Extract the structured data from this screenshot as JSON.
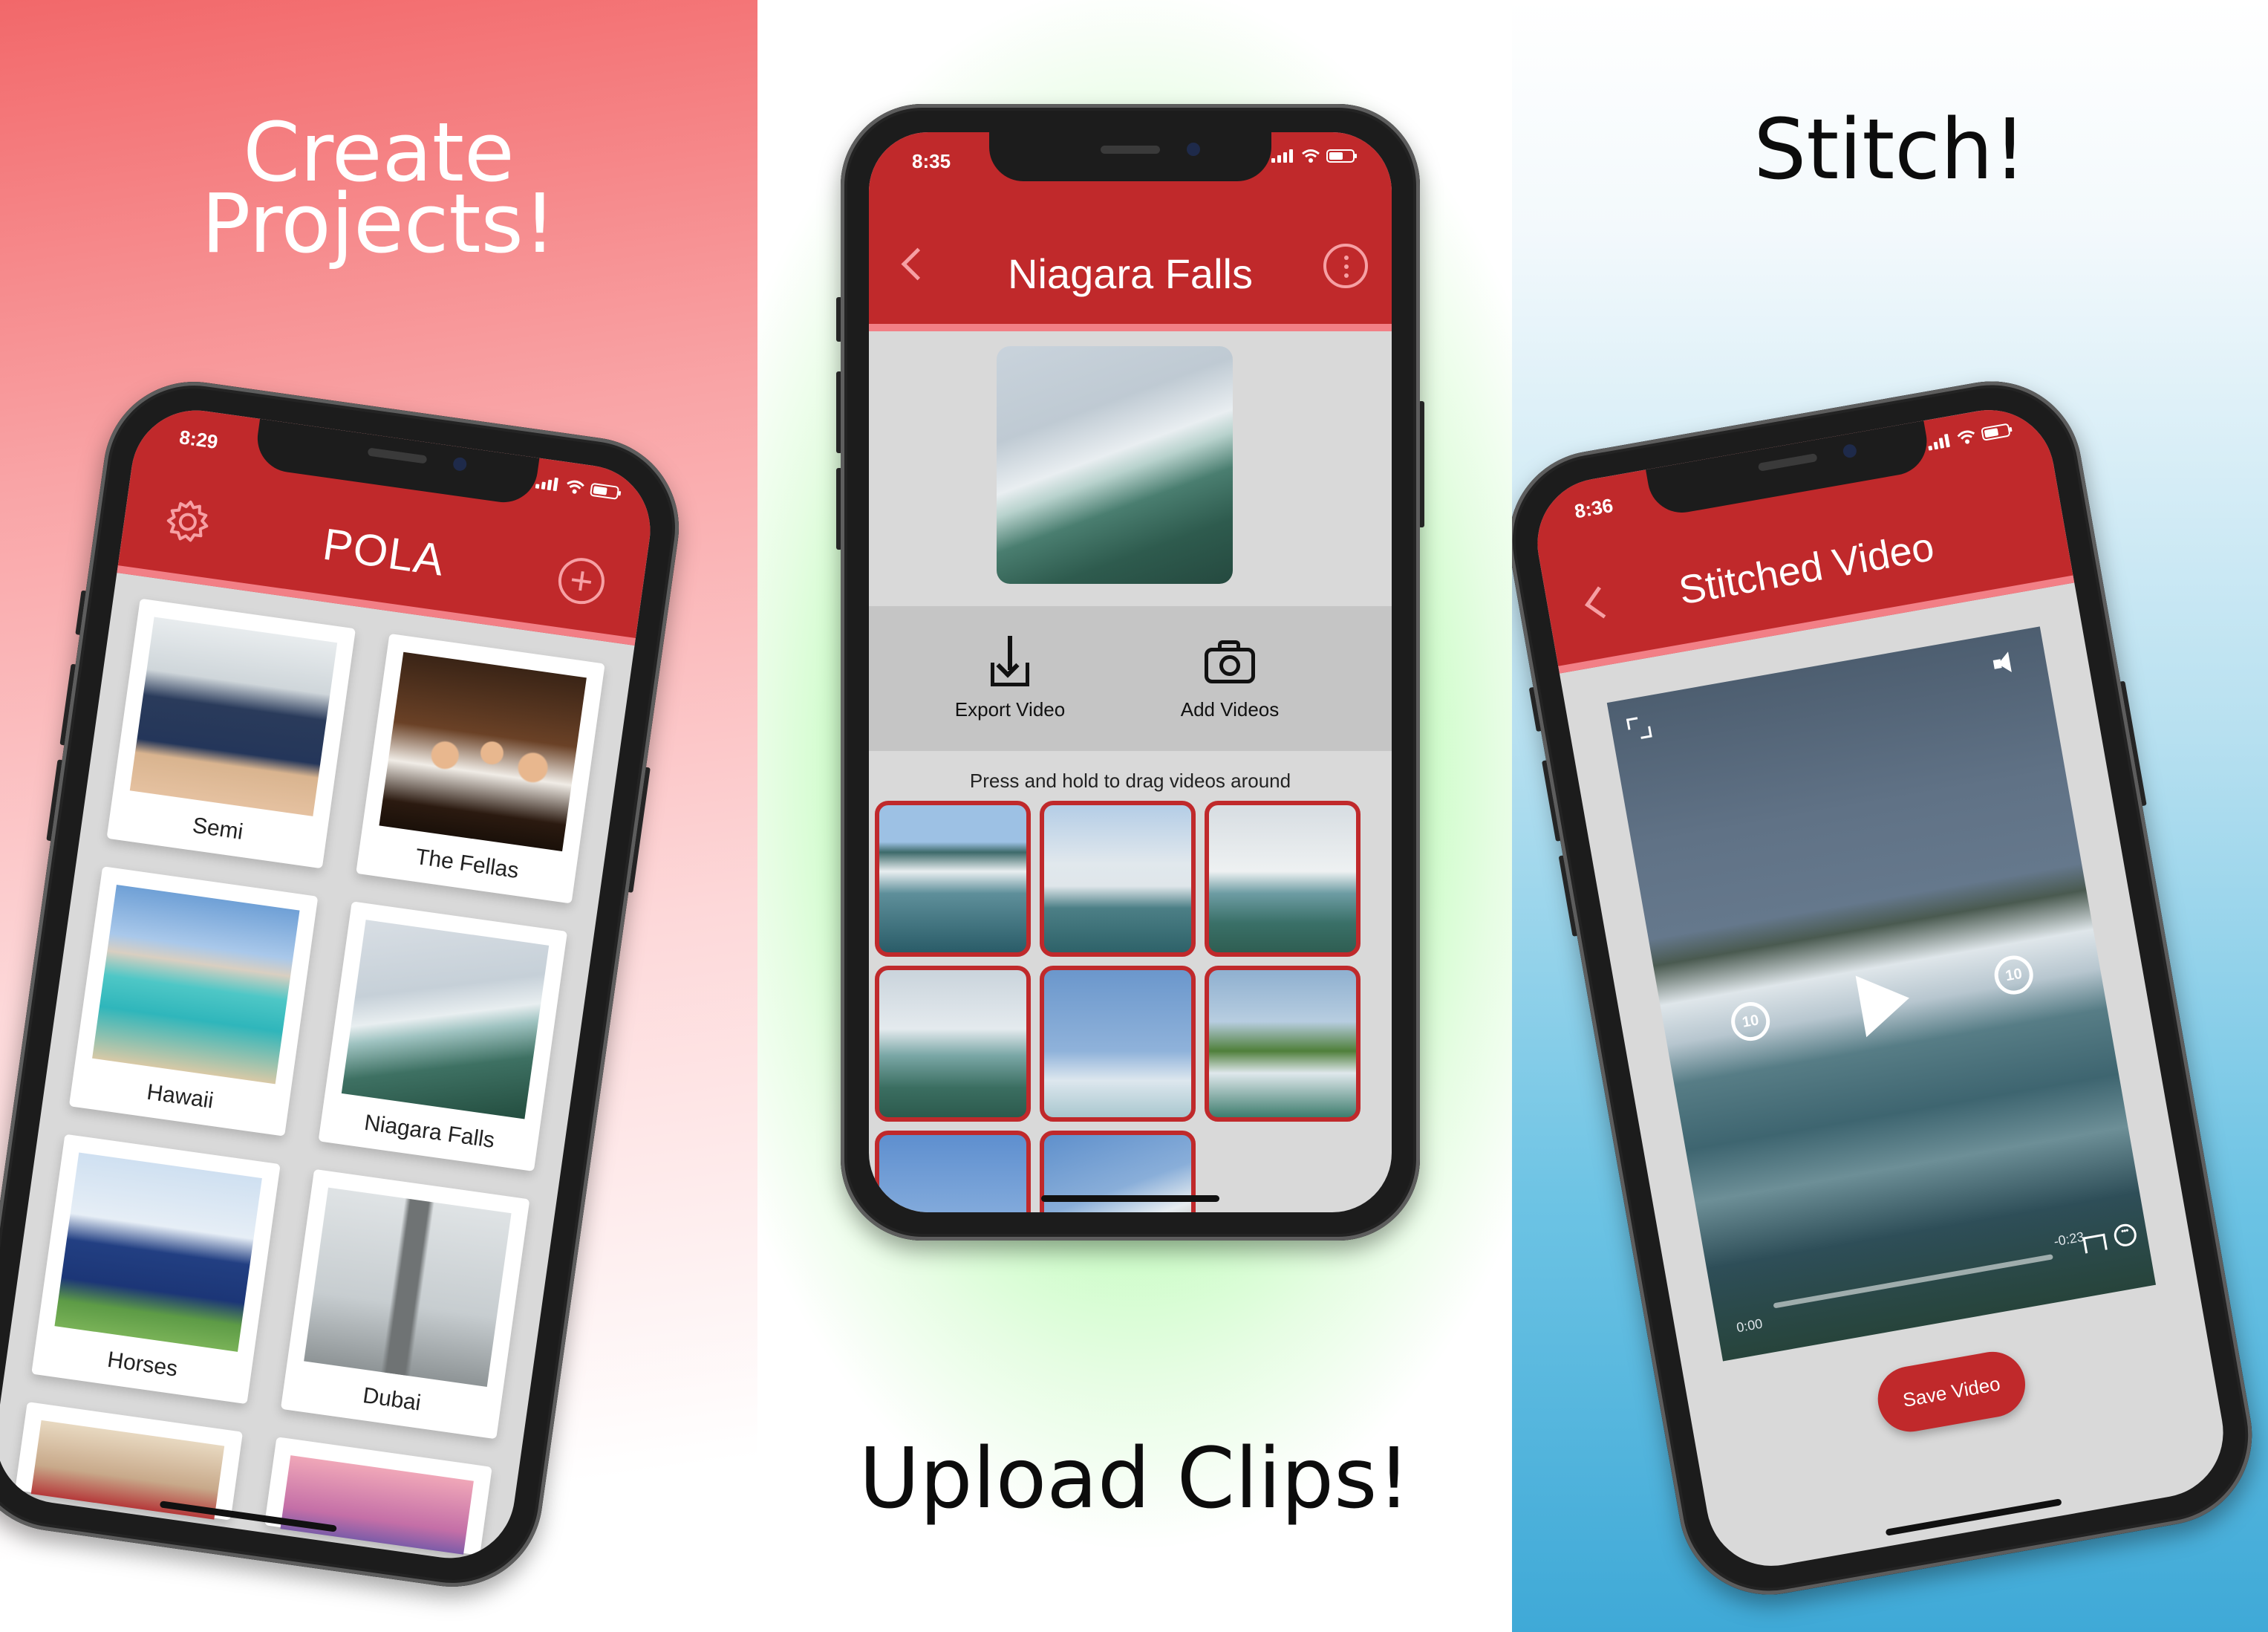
{
  "headlines": {
    "create_line1": "Create",
    "create_line2": "Projects!",
    "upload": "Upload Clips!",
    "stitch": "Stitch!"
  },
  "phone_left": {
    "status_time": "8:29",
    "title": "POLA",
    "icons": {
      "left": "gear-icon",
      "right": "plus-circle-icon"
    },
    "projects": [
      {
        "caption": "Semi"
      },
      {
        "caption": "The Fellas"
      },
      {
        "caption": "Hawaii"
      },
      {
        "caption": "Niagara Falls"
      },
      {
        "caption": "Horses"
      },
      {
        "caption": "Dubai"
      }
    ]
  },
  "phone_middle": {
    "status_time": "8:35",
    "title": "Niagara Falls",
    "icons": {
      "left": "back-chevron-icon",
      "right": "more-options-icon"
    },
    "actions": {
      "export_label": "Export Video",
      "add_label": "Add Videos"
    },
    "drag_hint": "Press and hold to drag videos around",
    "clip_count_visible": 8
  },
  "phone_right": {
    "status_time": "8:36",
    "title": "Stitched Video",
    "player": {
      "skip_seconds": "10",
      "time_elapsed": "0:00",
      "time_remaining": "-0:23"
    },
    "save_label": "Save Video"
  },
  "colors": {
    "header_red": "#c0292b",
    "header_accent_pink": "#f27f86",
    "screen_gray": "#d9d9d9"
  }
}
